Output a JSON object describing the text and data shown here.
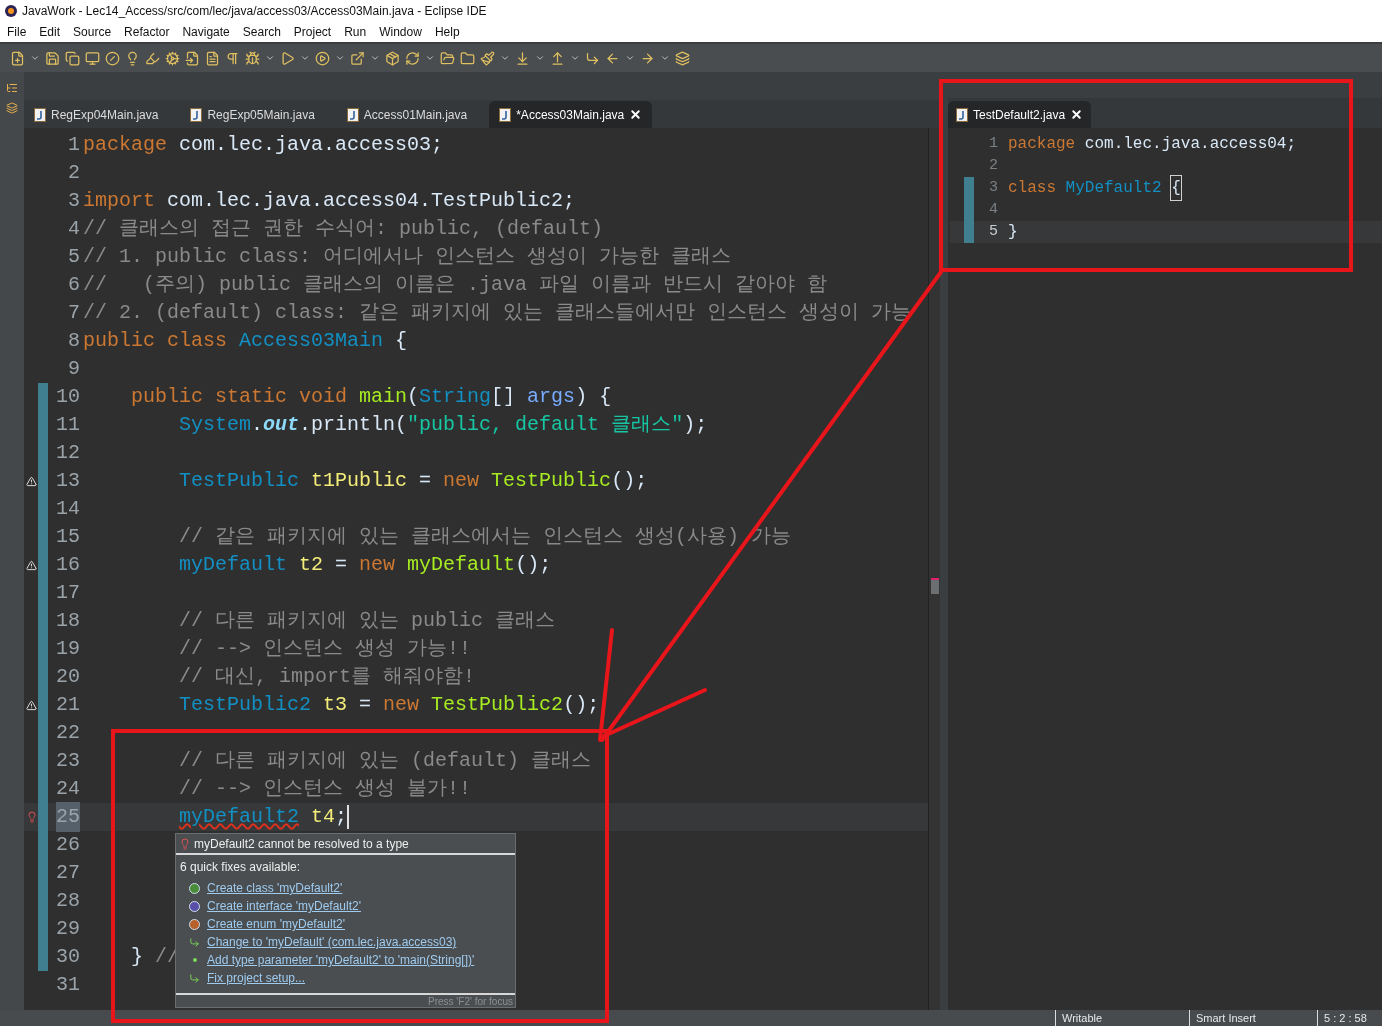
{
  "window": {
    "title": "JavaWork - Lec14_Access/src/com/lec/java/access03/Access03Main.java - Eclipse IDE"
  },
  "menu": [
    "File",
    "Edit",
    "Source",
    "Refactor",
    "Navigate",
    "Search",
    "Project",
    "Run",
    "Window",
    "Help"
  ],
  "editor_tabs": [
    {
      "label": "RegExp04Main.java",
      "selected": false
    },
    {
      "label": "RegExp05Main.java",
      "selected": false
    },
    {
      "label": "Access01Main.java",
      "selected": false
    },
    {
      "label": "*Access03Main.java",
      "selected": true
    }
  ],
  "main_editor": {
    "lines": [
      {
        "number": "1",
        "changed": false,
        "current": false,
        "tokens": [
          {
            "kind": "keyword",
            "text": "package"
          },
          {
            "kind": "plain",
            "text": " com.lec.java.access03;"
          }
        ]
      },
      {
        "number": "2",
        "changed": false,
        "current": false
      },
      {
        "number": "3",
        "changed": false,
        "current": false,
        "tokens": [
          {
            "kind": "keyword",
            "text": "import"
          },
          {
            "kind": "plain",
            "text": " com.lec.java.access04.TestPublic2;"
          }
        ]
      },
      {
        "number": "4",
        "changed": false,
        "current": false,
        "tokens": [
          {
            "kind": "comment",
            "text": "// 클래스의 접근 권한 수식어: public, (default)"
          }
        ]
      },
      {
        "number": "5",
        "changed": false,
        "current": false,
        "tokens": [
          {
            "kind": "comment",
            "text": "// 1. public class: 어디에서나 인스턴스 생성이 가능한 클래스"
          }
        ]
      },
      {
        "number": "6",
        "changed": false,
        "current": false,
        "tokens": [
          {
            "kind": "comment",
            "text": "//   (주의) public 클래스의 이름은 .java 파일 이름과 반드시 같아야 함"
          }
        ]
      },
      {
        "number": "7",
        "changed": false,
        "current": false,
        "tokens": [
          {
            "kind": "comment",
            "text": "// 2. (default) class: 같은 패키지에 있는 클래스들에서만 인스턴스 생성이 가능"
          }
        ]
      },
      {
        "number": "8",
        "changed": false,
        "current": false,
        "tokens": [
          {
            "kind": "keyword",
            "text": "public class "
          },
          {
            "kind": "type",
            "text": "Access03Main"
          },
          {
            "kind": "plain",
            "text": " {"
          }
        ]
      },
      {
        "number": "9",
        "changed": false,
        "current": false
      },
      {
        "number": "10",
        "changed": true,
        "current": false,
        "tokens": [
          {
            "kind": "keyword",
            "text": "    public static void "
          },
          {
            "kind": "method",
            "text": "main"
          },
          {
            "kind": "plain",
            "text": "("
          },
          {
            "kind": "type",
            "text": "String"
          },
          {
            "kind": "plain",
            "text": "[] "
          },
          {
            "kind": "param",
            "text": "args"
          },
          {
            "kind": "plain",
            "text": ") {"
          }
        ]
      },
      {
        "number": "11",
        "changed": true,
        "current": false,
        "tokens": [
          {
            "kind": "type",
            "text": "        System"
          },
          {
            "kind": "plain",
            "text": "."
          },
          {
            "kind": "field",
            "text": "out"
          },
          {
            "kind": "plain",
            "text": ".println("
          },
          {
            "kind": "string",
            "text": "\"public, default 클래스\""
          },
          {
            "kind": "plain",
            "text": ");"
          }
        ]
      },
      {
        "number": "12",
        "changed": true,
        "current": false
      },
      {
        "number": "13",
        "changed": true,
        "current": false,
        "kind": "warning",
        "tokens": [
          {
            "kind": "type",
            "text": "        TestPublic "
          },
          {
            "kind": "variable",
            "text": "t1Public"
          },
          {
            "kind": "plain",
            "text": " = "
          },
          {
            "kind": "keyword",
            "text": "new "
          },
          {
            "kind": "method",
            "text": "TestPublic"
          },
          {
            "kind": "plain",
            "text": "();"
          }
        ]
      },
      {
        "number": "14",
        "changed": true,
        "current": false
      },
      {
        "number": "15",
        "changed": true,
        "current": false,
        "tokens": [
          {
            "kind": "comment",
            "text": "        // 같은 패키지에 있는 클래스에서는 인스턴스 생성(사용) 가능"
          }
        ]
      },
      {
        "number": "16",
        "changed": true,
        "current": false,
        "kind": "warning",
        "tokens": [
          {
            "kind": "type",
            "text": "        myDefault "
          },
          {
            "kind": "variable",
            "text": "t2"
          },
          {
            "kind": "plain",
            "text": " = "
          },
          {
            "kind": "keyword",
            "text": "new "
          },
          {
            "kind": "method",
            "text": "myDefault"
          },
          {
            "kind": "plain",
            "text": "();"
          }
        ]
      },
      {
        "number": "17",
        "changed": true,
        "current": false
      },
      {
        "number": "18",
        "changed": true,
        "current": false,
        "tokens": [
          {
            "kind": "comment",
            "text": "        // 다른 패키지에 있는 public 클래스"
          }
        ]
      },
      {
        "number": "19",
        "changed": true,
        "current": false,
        "tokens": [
          {
            "kind": "comment",
            "text": "        // --> 인스턴스 생성 가능!!"
          }
        ]
      },
      {
        "number": "20",
        "changed": true,
        "current": false,
        "tokens": [
          {
            "kind": "comment",
            "text": "        // 대신, import를 해줘야함!"
          }
        ]
      },
      {
        "number": "21",
        "changed": true,
        "current": false,
        "kind": "warning",
        "tokens": [
          {
            "kind": "type",
            "text": "        TestPublic2 "
          },
          {
            "kind": "variable",
            "text": "t3"
          },
          {
            "kind": "plain",
            "text": " = "
          },
          {
            "kind": "keyword",
            "text": "new "
          },
          {
            "kind": "method",
            "text": "TestPublic2"
          },
          {
            "kind": "plain",
            "text": "();"
          }
        ]
      },
      {
        "number": "22",
        "changed": true,
        "current": false
      },
      {
        "number": "23",
        "changed": true,
        "current": false,
        "tokens": [
          {
            "kind": "comment",
            "text": "        // 다른 패키지에 있는 (default) 클래스"
          }
        ]
      },
      {
        "number": "24",
        "changed": true,
        "current": false,
        "tokens": [
          {
            "kind": "comment",
            "text": "        // --> 인스턴스 생성 불가!!"
          }
        ]
      },
      {
        "number": "25",
        "changed": true,
        "current": true,
        "kind": "error",
        "tokens": [
          {
            "kind": "error_type",
            "text": "        myDefault2"
          },
          {
            "kind": "variable",
            "text": " t4"
          },
          {
            "kind": "plain",
            "text": ";"
          }
        ]
      },
      {
        "number": "26",
        "changed": true,
        "current": false
      },
      {
        "number": "27",
        "changed": true,
        "current": false
      },
      {
        "number": "28",
        "changed": true,
        "current": false
      },
      {
        "number": "29",
        "changed": true,
        "current": false
      },
      {
        "number": "30",
        "changed": true,
        "current": false,
        "tokens": [
          {
            "kind": "plain",
            "text": "    } "
          },
          {
            "kind": "comment",
            "text": "//"
          }
        ]
      },
      {
        "number": "31",
        "changed": false,
        "current": false
      }
    ]
  },
  "quick_fix_popup": {
    "problem": "myDefault2 cannot be resolved to a type",
    "heading": "6 quick fixes available:",
    "fixes": [
      {
        "kind": "class",
        "label": "Create class 'myDefault2'"
      },
      {
        "kind": "interface",
        "label": "Create interface 'myDefault2'"
      },
      {
        "kind": "enum",
        "label": "Create enum 'myDefault2'"
      },
      {
        "kind": "change",
        "label": "Change to 'myDefault' (com.lec.java.access03)"
      },
      {
        "kind": "add",
        "label": "Add type parameter 'myDefault2' to 'main(String[])'"
      },
      {
        "kind": "change",
        "label": "Fix project setup..."
      }
    ],
    "footer": "Press 'F2' for focus"
  },
  "side_editor": {
    "tab": {
      "label": "TestDefault2.java",
      "selected": true
    },
    "lines": [
      {
        "number": "1",
        "changed": false,
        "current": false,
        "tokens": [
          {
            "kind": "keyword",
            "text": "package"
          },
          {
            "kind": "plain",
            "text": " com.lec.java.access04;"
          }
        ]
      },
      {
        "number": "2",
        "changed": false,
        "current": false
      },
      {
        "number": "3",
        "changed": true,
        "current": false,
        "tokens": [
          {
            "kind": "keyword",
            "text": "class "
          },
          {
            "kind": "type",
            "text": "MyDefault2 "
          },
          {
            "kind": "bracket",
            "text": "{"
          }
        ]
      },
      {
        "number": "4",
        "changed": true,
        "current": false
      },
      {
        "number": "5",
        "changed": true,
        "current": true,
        "tokens": [
          {
            "kind": "plain",
            "text": "}"
          }
        ]
      }
    ]
  },
  "status_bar": {
    "mode": "Writable",
    "insert": "Smart Insert",
    "position": "5 : 2 : 58"
  }
}
